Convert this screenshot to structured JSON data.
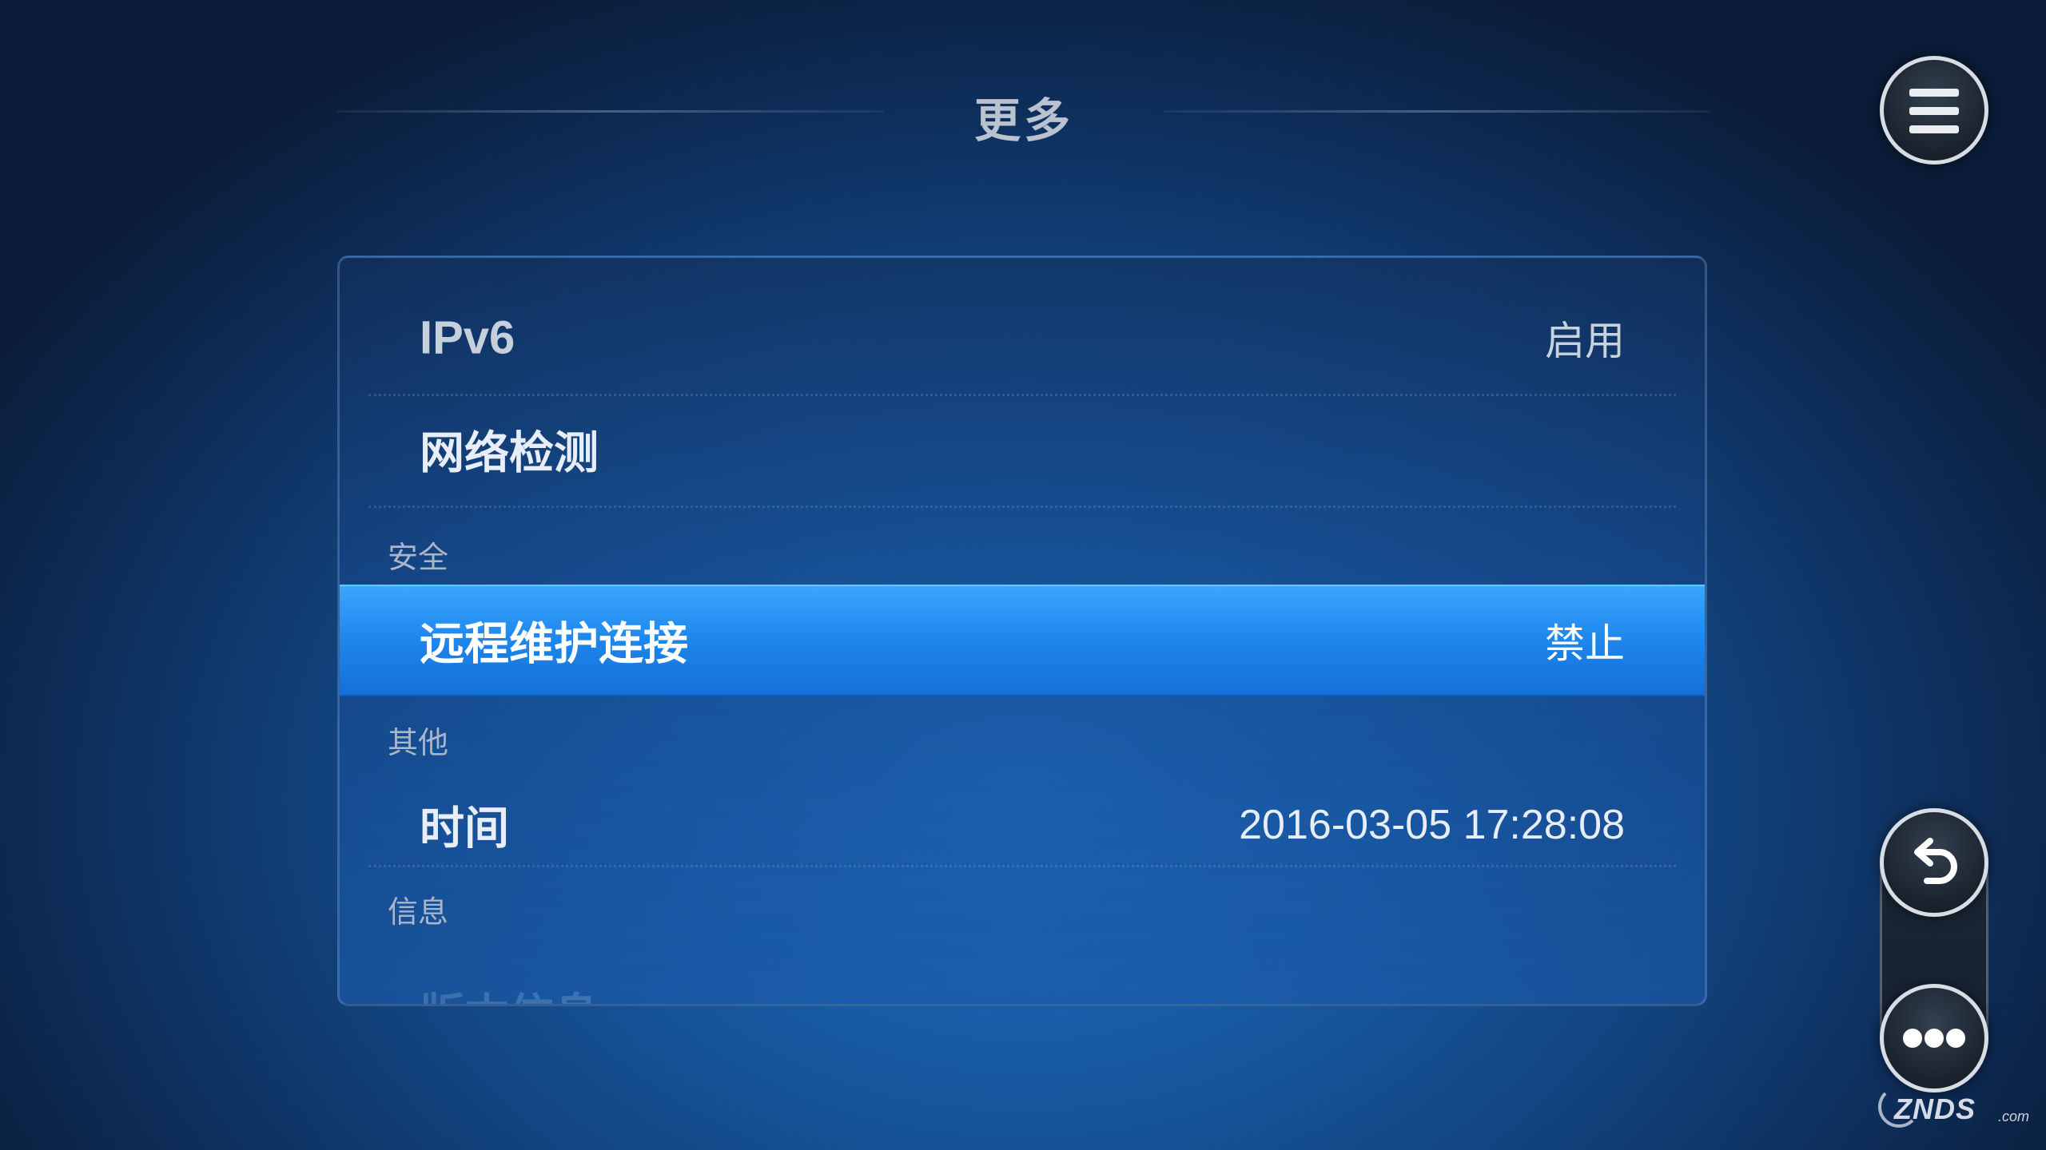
{
  "header": {
    "title": "更多"
  },
  "settings": {
    "ipv6": {
      "label": "IPv6",
      "value": "启用"
    },
    "network_check": {
      "label": "网络检测"
    },
    "section_security": "安全",
    "remote_maintenance": {
      "label": "远程维护连接",
      "value": "禁止"
    },
    "section_other": "其他",
    "time": {
      "label": "时间",
      "value": "2016-03-05 17:28:08"
    },
    "section_info": "信息",
    "version_info": {
      "label": "版本信息"
    }
  },
  "controls": {
    "menu_icon": "hamburger-menu-icon",
    "back_icon": "back-arrow-icon",
    "more_icon": "more-dots-icon"
  },
  "watermark": {
    "brand": "ZNDS",
    "suffix": ".com"
  },
  "colors": {
    "highlight": "#1e86ec",
    "background": "#175aa3"
  }
}
